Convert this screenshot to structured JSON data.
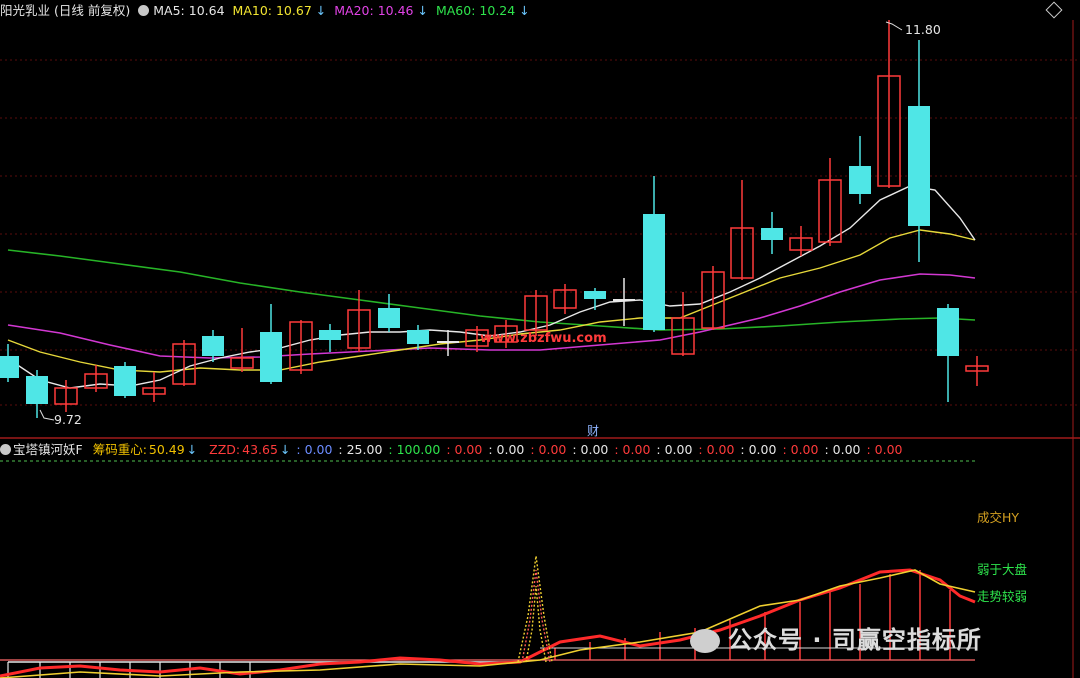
{
  "header": {
    "stock": "阳光乳业",
    "period": "(日线 前复权)",
    "ma5_label": "MA5:",
    "ma5_value": "10.64",
    "ma10_label": "MA10:",
    "ma10_value": "10.67",
    "ma20_label": "MA20:",
    "ma20_value": "10.46",
    "ma60_label": "MA60:",
    "ma60_value": "10.24",
    "down_arrow": "↓"
  },
  "main_chart": {
    "high_label": "11.80",
    "low_label": "9.72",
    "watermark_url": "www.zbzfwu.com",
    "finance_marker": "财",
    "colors": {
      "up": "#ff3b3b",
      "down": "#4fe6e6",
      "ma5": "#e8e8e8",
      "ma10": "#e6d83a",
      "ma20": "#d238d2",
      "ma60": "#27b427",
      "grid": "#5a0b0b"
    }
  },
  "sub_header": {
    "indicator_name": "宝塔镇河妖F",
    "chip_label": "筹码重心:",
    "chip_value": "50.49",
    "zzd_label": "ZZD:",
    "zzd_value": "43.65",
    "v1": ": 0.00",
    "v2": ": 25.00",
    "v3": ": 100.00",
    "r1": ": 0.00",
    "w1": ": 0.00",
    "r2": ": 0.00",
    "w2": ": 0.00",
    "r3": ": 0.00",
    "w3": ": 0.00",
    "r4": ": 0.00",
    "w4": ": 0.00",
    "r5": ": 0.00",
    "w5": ": 0.00",
    "r6": ": 0.00"
  },
  "sub_labels": {
    "vol_label": "成交HY",
    "weak_label": "弱于大盘",
    "trend_label": "走势较弱"
  },
  "footer_watermark": "公众号 · 司赢空指标所"
}
